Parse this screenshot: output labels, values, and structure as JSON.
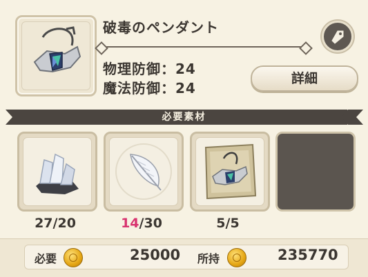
{
  "item": {
    "name": "破毒のペンダント",
    "stats": [
      {
        "label": "物理防御：24"
      },
      {
        "label": "魔法防御：24"
      }
    ]
  },
  "buttons": {
    "detail": "詳細"
  },
  "materials": {
    "header": "必要素材",
    "slots": [
      {
        "icon": "crystal-ore-icon",
        "count_have": "27",
        "count_sep": "/20"
      },
      {
        "icon": "white-feather-icon",
        "count_have": "14",
        "count_sep": "/30"
      },
      {
        "icon": "pendant-scroll-icon",
        "count_have": "5",
        "count_sep": "/5"
      },
      {
        "icon": "empty-slot",
        "count_have": "",
        "count_sep": ""
      }
    ]
  },
  "cost": {
    "required_label": "必要",
    "required_value": "25000",
    "owned_label": "所持",
    "owned_value": "235770"
  },
  "colors": {
    "highlight": "#d8336f",
    "banner": "#4b4540"
  }
}
